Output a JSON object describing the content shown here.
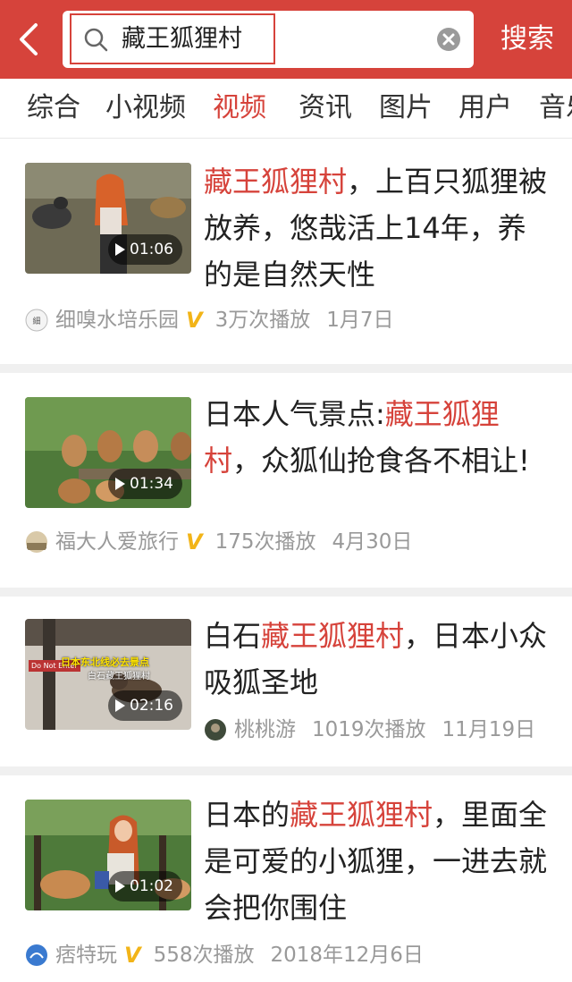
{
  "search": {
    "query": "藏王狐狸村",
    "button_label": "搜索"
  },
  "tabs": [
    {
      "label": "综合",
      "active": false
    },
    {
      "label": "小视频",
      "active": false
    },
    {
      "label": "视频",
      "active": true
    },
    {
      "label": "资讯",
      "active": false
    },
    {
      "label": "图片",
      "active": false
    },
    {
      "label": "用户",
      "active": false
    },
    {
      "label": "音乐",
      "active": false
    }
  ],
  "results": [
    {
      "title_highlight": "藏王狐狸村",
      "title_after": "，上百只狐狸被放养，悠哉活上14年，养的是自然天性",
      "duration": "01:06",
      "author": "细嗅水培乐园",
      "verified": true,
      "plays": "3万次播放",
      "date": "1月7日"
    },
    {
      "title_before": "日本人气景点:",
      "title_highlight": "藏王狐狸村",
      "title_after": "，众狐仙抢食各不相让!",
      "duration": "01:34",
      "author": "福大人爱旅行",
      "verified": true,
      "plays": "175次播放",
      "date": "4月30日"
    },
    {
      "title_before": "白石",
      "title_highlight": "藏王狐狸村",
      "title_after": "，日本小众吸狐圣地",
      "duration": "02:16",
      "thumb_caption": "日本东北线必去景点",
      "thumb_caption2": "白石藏王狐狸村",
      "thumb_sign": "Do Not Enter",
      "author": "桃桃游",
      "verified": false,
      "plays": "1019次播放",
      "date": "11月19日"
    },
    {
      "title_before": "日本的",
      "title_highlight": "藏王狐狸村",
      "title_after": "，里面全是可爱的小狐狸，一进去就会把你围住",
      "duration": "01:02",
      "author": "痞特玩",
      "verified": true,
      "plays": "558次播放",
      "date": "2018年12月6日"
    }
  ],
  "verified_mark": "V",
  "colors": {
    "accent": "#d6433b",
    "verified": "#f2b418",
    "muted": "#999999"
  }
}
